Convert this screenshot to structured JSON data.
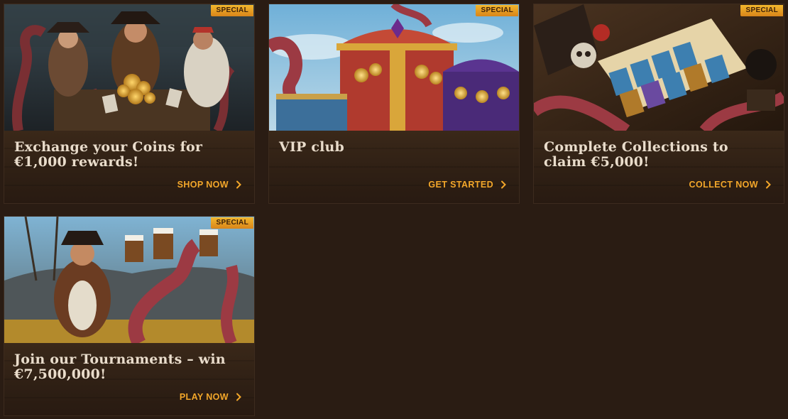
{
  "badge_text": "SPECIAL",
  "colors": {
    "background": "#2a1c13",
    "card_panel": "#2e1f14",
    "title_text": "#e9dccb",
    "cta_text": "#f3a72a",
    "badge": "#f2b72d"
  },
  "promos": [
    {
      "title": "Exchange your Coins for €1,000 rewards!",
      "cta": "SHOP NOW",
      "image": "pirates-trading-coins-illustration"
    },
    {
      "title": "VIP club",
      "cta": "GET STARTED",
      "image": "treasure-chests-illustration"
    },
    {
      "title": "Complete Collections to claim €5,000!",
      "cta": "COLLECT NOW",
      "image": "card-album-illustration"
    },
    {
      "title": "Join our Tournaments – win €7,500,000!",
      "cta": "PLAY NOW",
      "image": "pirate-captain-tankards-illustration"
    }
  ]
}
